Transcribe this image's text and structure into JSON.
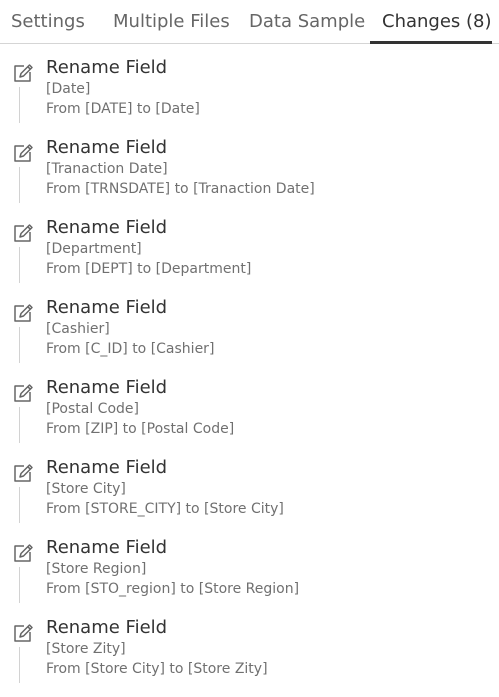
{
  "tabs": [
    {
      "label": "Settings"
    },
    {
      "label": "Multiple Files"
    },
    {
      "label": "Data Sample"
    },
    {
      "label": "Changes (8)"
    }
  ],
  "active_tab": "Changes (8)",
  "changes": [
    {
      "icon": "edit-icon",
      "title": "Rename Field",
      "field": "[Date]",
      "detail": "From [DATE] to [Date]"
    },
    {
      "icon": "edit-icon",
      "title": "Rename Field",
      "field": "[Tranaction Date]",
      "detail": "From [TRNSDATE] to [Tranaction Date]"
    },
    {
      "icon": "edit-icon",
      "title": "Rename Field",
      "field": "[Department]",
      "detail": "From [DEPT] to [Department]"
    },
    {
      "icon": "edit-icon",
      "title": "Rename Field",
      "field": "[Cashier]",
      "detail": "From [C_ID] to [Cashier]"
    },
    {
      "icon": "edit-icon",
      "title": "Rename Field",
      "field": "[Postal Code]",
      "detail": "From [ZIP] to [Postal Code]"
    },
    {
      "icon": "edit-icon",
      "title": "Rename Field",
      "field": "[Store City]",
      "detail": "From [STORE_CITY] to [Store City]"
    },
    {
      "icon": "edit-icon",
      "title": "Rename Field",
      "field": "[Store Region]",
      "detail": "From [STO_region] to [Store Region]"
    },
    {
      "icon": "edit-icon",
      "title": "Rename Field",
      "field": "[Store Zity]",
      "detail": "From [Store City] to [Store Zity]"
    }
  ],
  "colors": {
    "text_primary": "#333333",
    "text_secondary": "#707070",
    "tab_inactive": "#666666",
    "active_underline": "#333333"
  }
}
